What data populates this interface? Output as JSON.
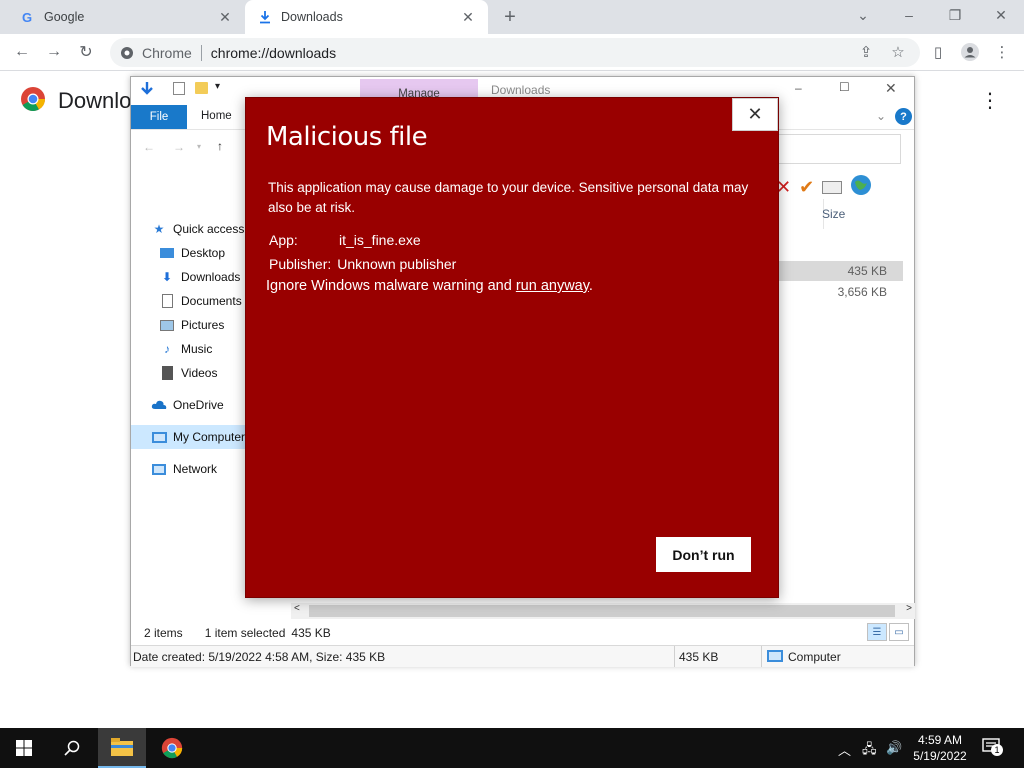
{
  "browser": {
    "tabs": [
      {
        "title": "Google",
        "icon": "google-g-icon"
      },
      {
        "title": "Downloads",
        "icon": "download-icon"
      }
    ],
    "omnibox": {
      "site_label": "Chrome",
      "url": "chrome://downloads"
    }
  },
  "downloads_page": {
    "title": "Downloads"
  },
  "explorer": {
    "manage_tab": "Manage",
    "context_title": "Downloads",
    "ribbon_tabs": {
      "file": "File",
      "home": "Home"
    },
    "size_header": "Size",
    "sizes": [
      "435 KB",
      "3,656 KB"
    ],
    "sidebar": {
      "quick_access": "Quick access",
      "desktop": "Desktop",
      "downloads": "Downloads",
      "documents": "Documents",
      "pictures": "Pictures",
      "music": "Music",
      "videos": "Videos",
      "onedrive": "OneDrive",
      "my_computer": "My Computer",
      "network": "Network"
    },
    "status": {
      "items": "2 items",
      "selected": "1 item selected",
      "selected_size": "435 KB",
      "date_created": "Date created: 5/19/2022 4:58 AM, Size: 435 KB",
      "size": "435 KB",
      "computer": "Computer"
    }
  },
  "dialog": {
    "title": "Malicious file",
    "message": "This application may cause damage to your device. Sensitive personal data may also be at risk.",
    "app_label": "App:",
    "app_value": "it_is_fine.exe",
    "publisher_label": "Publisher:",
    "publisher_value": "Unknown publisher",
    "ignore_text": "Ignore Windows malware warning and ",
    "ignore_link": "run anyway",
    "ignore_end": ".",
    "dont_run": "Don’t run",
    "bg_color": "#990000"
  },
  "taskbar": {
    "time": "4:59 AM",
    "date": "5/19/2022",
    "notification_count": "1"
  }
}
